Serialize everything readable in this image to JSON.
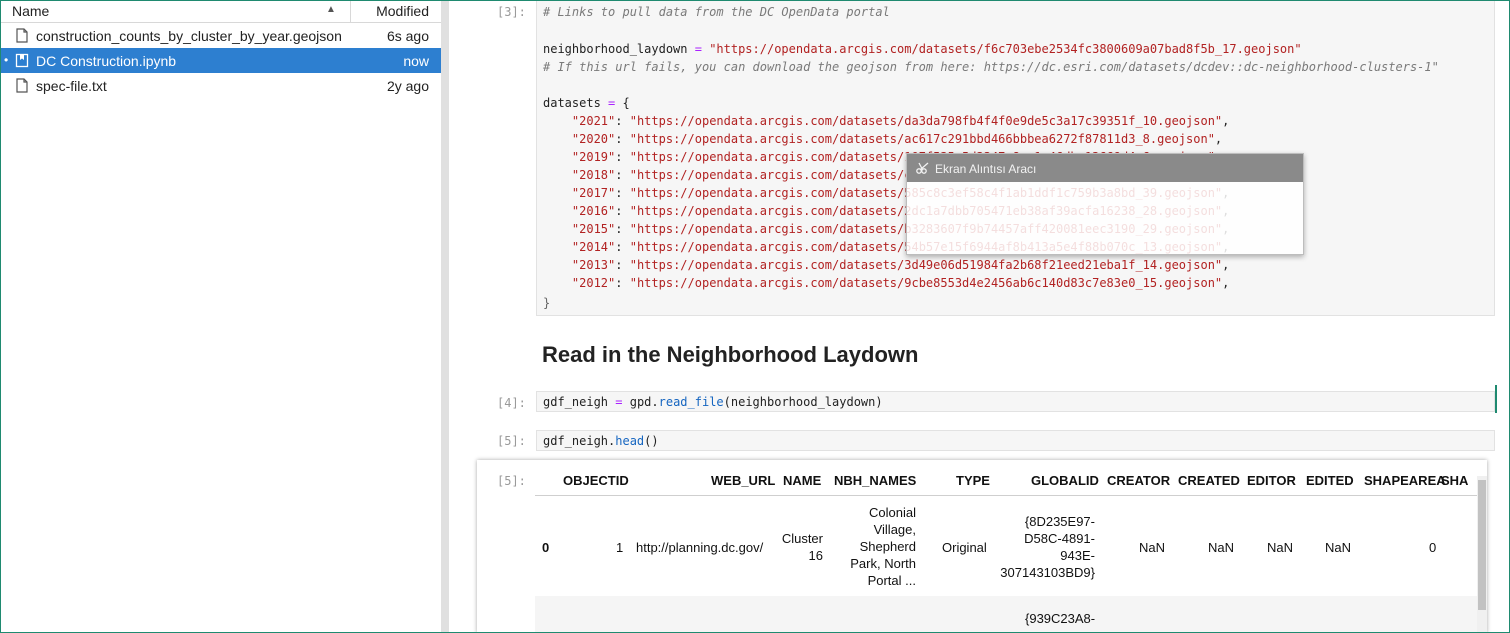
{
  "file_browser": {
    "header": {
      "name_label": "Name",
      "modified_label": "Modified"
    },
    "files": [
      {
        "name": "construction_counts_by_cluster_by_year.geojson",
        "modified": "6s ago",
        "icon": "file-icon"
      },
      {
        "name": "DC Construction.ipynb",
        "modified": "now",
        "icon": "notebook-icon",
        "selected": true
      },
      {
        "name": "spec-file.txt",
        "modified": "2y ago",
        "icon": "file-icon"
      }
    ]
  },
  "notebook": {
    "cell3": {
      "prompt": "[3]:",
      "comment1": "# Links to pull data from the DC OpenData portal",
      "neigh_var": "neighborhood_laydown",
      "eq": " = ",
      "neigh_url": "\"https://opendata.arcgis.com/datasets/f6c703ebe2534fc3800609a07bad8f5b_17.geojson\"",
      "comment2": "# If this url fails, you can download the geojson from here: https://dc.esri.com/datasets/dcdev::dc-neighborhood-clusters-1\"",
      "datasets_var": "datasets",
      "open_brace": "{",
      "close_brace": "}",
      "datasets": [
        {
          "year": "\"2021\"",
          "url": "\"https://opendata.arcgis.com/datasets/da3da798fb4f4f0e9de5c3a17c39351f_10.geojson\""
        },
        {
          "year": "\"2020\"",
          "url": "\"https://opendata.arcgis.com/datasets/ac617c291bbd466bbbea6272f87811d3_8.geojson\""
        },
        {
          "year": "\"2019\"",
          "url": "\"https://opendata.arcgis.com/datasets/107f535e5d3347a8ac1e46dbc13669d4_6.geojson\""
        },
        {
          "year": "\"2018\"",
          "url": "\"https://opendata.arcgis.com/datasets/ca581e1b455a46caa266e3476f8205d2_0.geojson\""
        },
        {
          "year": "\"2017\"",
          "url": "\"https://opendata.arcgis.com/datasets/585c8c3ef58c4f1ab1ddf1c759b3a8bd_39.geojson\""
        },
        {
          "year": "\"2016\"",
          "url": "\"https://opendata.arcgis.com/datasets/2dc1a7dbb705471eb38af39acfa16238_28.geojson\""
        },
        {
          "year": "\"2015\"",
          "url": "\"https://opendata.arcgis.com/datasets/b3283607f9b74457aff420081eec3190_29.geojson\""
        },
        {
          "year": "\"2014\"",
          "url": "\"https://opendata.arcgis.com/datasets/54b57e15f6944af8b413a5e4f88b070c_13.geojson\""
        },
        {
          "year": "\"2013\"",
          "url": "\"https://opendata.arcgis.com/datasets/3d49e06d51984fa2b68f21eed21eba1f_14.geojson\""
        },
        {
          "year": "\"2012\"",
          "url": "\"https://opendata.arcgis.com/datasets/9cbe8553d4e2456ab6c140d83c7e83e0_15.geojson\""
        }
      ]
    },
    "markdown_heading": "Read in the Neighborhood Laydown",
    "cell4": {
      "prompt": "[4]:",
      "var": "gdf_neigh",
      "eq": " = ",
      "mod": "gpd.",
      "fn": "read_file",
      "args": "(neighborhood_laydown)"
    },
    "cell5": {
      "prompt": "[5]:",
      "var": "gdf_neigh.",
      "fn": "head",
      "args": "()"
    },
    "output": {
      "prompt": "[5]:",
      "columns": [
        "OBJECTID",
        "WEB_URL",
        "NAME",
        "NBH_NAMES",
        "TYPE",
        "GLOBALID",
        "CREATOR",
        "CREATED",
        "EDITOR",
        "EDITED",
        "SHAPEAREA",
        "SHA"
      ],
      "row0": {
        "index": "0",
        "objectid": "1",
        "web_url": "http://planning.dc.gov/",
        "name": [
          "Cluster",
          "16"
        ],
        "nbh_names": [
          "Colonial",
          "Village,",
          "Shepherd",
          "Park, North",
          "Portal ..."
        ],
        "type": "Original",
        "globalid": [
          "{8D235E97-",
          "D58C-4891-",
          "943E-",
          "307143103BD9}"
        ],
        "creator": "NaN",
        "created": "NaN",
        "editor": "NaN",
        "edited": "NaN",
        "shapearea": "0"
      },
      "row1_globalid_partial": "{939C23A8-"
    }
  },
  "snip_tool": {
    "title": "Ekran Alıntısı Aracı"
  },
  "colors": {
    "accent": "#2d7fd0",
    "frame": "#1f8a70",
    "string": "#b22222",
    "comment": "#7a7a7a"
  }
}
